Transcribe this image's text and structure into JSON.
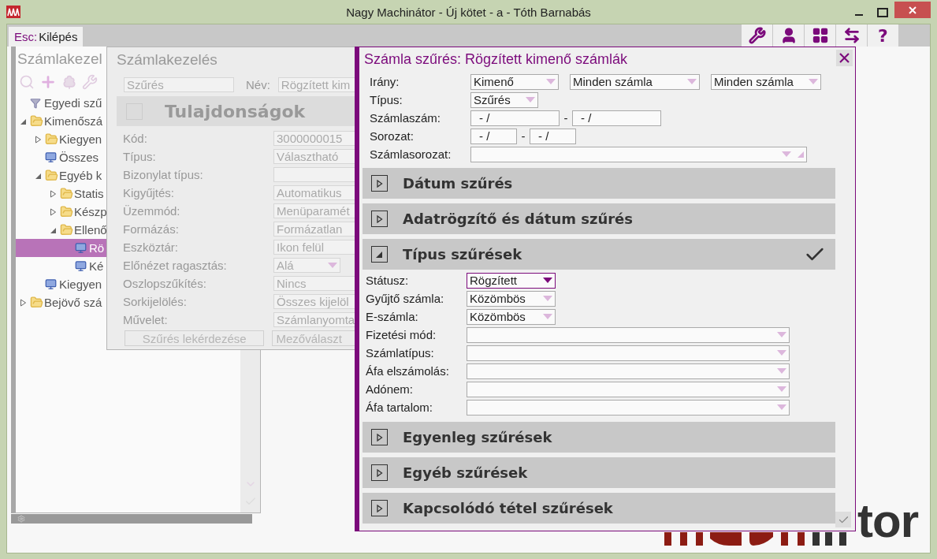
{
  "window": {
    "title": "Nagy Machinátor - Új kötet - a - Tóth Barnabás"
  },
  "top_bar": {
    "exit_key": "Esc:",
    "exit_label": "Kilépés",
    "help_label": "?"
  },
  "back_panel": {
    "title": "Számlakezel",
    "tree": [
      {
        "label": "Egyedi szű",
        "kind": "filter",
        "selected": false
      },
      {
        "label": "Kimenőszá",
        "kind": "folder",
        "expanded": true,
        "selected": false,
        "children": [
          {
            "label": "Kiegyen",
            "kind": "folder",
            "expanded": false,
            "selected": false
          },
          {
            "label": "Összes",
            "kind": "report",
            "selected": false
          },
          {
            "label": "Egyéb k",
            "kind": "folder",
            "expanded": true,
            "selected": false,
            "children": [
              {
                "label": "Statis",
                "kind": "folder",
                "expanded": false,
                "selected": false
              },
              {
                "label": "Készp",
                "kind": "folder",
                "expanded": false,
                "selected": false
              },
              {
                "label": "Ellenő",
                "kind": "folder",
                "expanded": true,
                "selected": false,
                "children": [
                  {
                    "label": "Rö",
                    "kind": "report",
                    "selected": true
                  },
                  {
                    "label": "Ké",
                    "kind": "report",
                    "selected": false
                  }
                ]
              }
            ]
          },
          {
            "label": "Kiegyen",
            "kind": "report",
            "selected": false
          }
        ]
      },
      {
        "label": "Bejövő szá",
        "kind": "folder",
        "expanded": false,
        "selected": false
      }
    ]
  },
  "middle_panel": {
    "title": "Számlakezelés",
    "filter_value": "Szűrés",
    "name_label": "Név:",
    "name_value": "Rögzített kim",
    "section": "Tulajdonságok",
    "properties": [
      {
        "label": "Kód:",
        "value": "3000000015",
        "kind": "text"
      },
      {
        "label": "Típus:",
        "value": "Választható",
        "kind": "text"
      },
      {
        "label": "Bizonylat típus:",
        "kind": "text"
      },
      {
        "label": "Kigyűjtés:",
        "value": "Automatikus",
        "kind": "text"
      },
      {
        "label": "Üzemmód:",
        "value": "Menüparamét",
        "kind": "text"
      },
      {
        "label": "Formázás:",
        "value": "Formázatlan",
        "kind": "text"
      },
      {
        "label": "Eszköztár:",
        "value": "Ikon felül",
        "kind": "text"
      },
      {
        "label": "Előnézet ragasztás:",
        "value": "Alá",
        "kind": "select"
      },
      {
        "label": "Oszlopszűkítés:",
        "value": "Nincs",
        "kind": "text"
      },
      {
        "label": "Sorkijelölés:",
        "value": "Összes kijelöl",
        "kind": "text"
      },
      {
        "label": "Művelet:",
        "value": "Számlanyomta",
        "kind": "text"
      }
    ],
    "buttons": [
      "Szűrés lekérdezése",
      "Mezőválaszt"
    ]
  },
  "dialog": {
    "title": "Számla szűrés: Rögzített kimenő számlák",
    "rows": [
      {
        "label": "Irány:",
        "kind": "selects",
        "values": [
          "Kimenő",
          "Minden számla",
          "Minden számla"
        ]
      },
      {
        "label": "Típus:",
        "kind": "selects",
        "values": [
          "Szűrés"
        ]
      },
      {
        "label": "Számlaszám:",
        "kind": "range",
        "values": [
          "- /",
          "- /"
        ],
        "separator": "-"
      },
      {
        "label": "Sorozat:",
        "kind": "short_range",
        "values": [
          "- /",
          "- /"
        ],
        "separator": "-"
      },
      {
        "label": "Számlasorozat:",
        "kind": "combo"
      }
    ],
    "sections": [
      {
        "title": "Dátum szűrés",
        "expanded": false,
        "checked": false
      },
      {
        "title": "Adatrögzítő és dátum szűrés",
        "expanded": false,
        "checked": false
      },
      {
        "title": "Típus szűrések",
        "expanded": true,
        "checked": true,
        "fields": [
          {
            "label": "Státusz:",
            "value": "Rögzített",
            "kind": "short",
            "focused": true
          },
          {
            "label": "Gyűjtő számla:",
            "value": "Közömbös",
            "kind": "short",
            "focused": false
          },
          {
            "label": "E-számla:",
            "value": "Közömbös",
            "kind": "short",
            "focused": false
          },
          {
            "label": "Fizetési mód:",
            "kind": "long",
            "focused": false
          },
          {
            "label": "Számlatípus:",
            "kind": "long",
            "focused": false
          },
          {
            "label": "Áfa elszámolás:",
            "kind": "long",
            "focused": false
          },
          {
            "label": "Adónem:",
            "kind": "long",
            "focused": false
          },
          {
            "label": "Áfa tartalom:",
            "kind": "long",
            "focused": false
          }
        ]
      },
      {
        "title": "Egyenleg szűrések",
        "expanded": false,
        "checked": false
      },
      {
        "title": "Egyéb szűrések",
        "expanded": false,
        "checked": false
      },
      {
        "title": "Kapcsolódó tétel szűrések",
        "expanded": false,
        "checked": false
      }
    ]
  },
  "logo": {
    "visible": "tor"
  }
}
